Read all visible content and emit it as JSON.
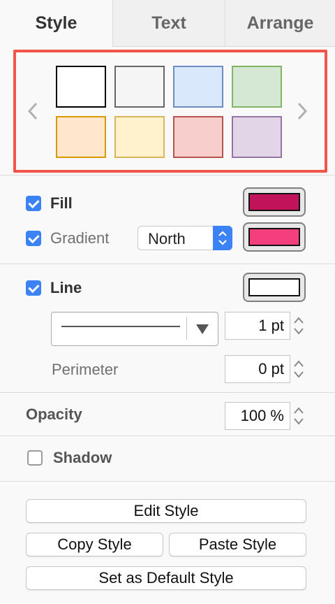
{
  "tabs": [
    {
      "label": "Style"
    },
    {
      "label": "Text"
    },
    {
      "label": "Arrange"
    }
  ],
  "swatches": [
    {
      "fill": "#ffffff",
      "stroke": "#000000"
    },
    {
      "fill": "#f5f5f5",
      "stroke": "#666666"
    },
    {
      "fill": "#dae8fc",
      "stroke": "#6c8ebf"
    },
    {
      "fill": "#d5e8d4",
      "stroke": "#82b366"
    },
    {
      "fill": "#ffe6cc",
      "stroke": "#d79b00"
    },
    {
      "fill": "#fff2cc",
      "stroke": "#d6b656"
    },
    {
      "fill": "#f8cecc",
      "stroke": "#b85450"
    },
    {
      "fill": "#e1d5e7",
      "stroke": "#9673a6"
    }
  ],
  "fill": {
    "label": "Fill",
    "checked": true,
    "color": "#c0135a"
  },
  "gradient": {
    "label": "Gradient",
    "checked": true,
    "direction": "North",
    "color": "#f43f7f"
  },
  "line": {
    "label": "Line",
    "checked": true,
    "color": "#ffffff",
    "width": "1 pt"
  },
  "perimeter": {
    "label": "Perimeter",
    "value": "0 pt"
  },
  "opacity": {
    "label": "Opacity",
    "value": "100 %"
  },
  "shadow": {
    "label": "Shadow",
    "checked": false
  },
  "buttons": {
    "edit_style": "Edit Style",
    "copy_style": "Copy Style",
    "paste_style": "Paste Style",
    "set_default": "Set as Default Style"
  },
  "icons": {
    "prev": "chevron-left-icon",
    "next": "chevron-right-icon",
    "select_arrows": "updown-chevron-icon",
    "dropdown": "triangle-down-icon",
    "stepper": "stepper-icon"
  }
}
